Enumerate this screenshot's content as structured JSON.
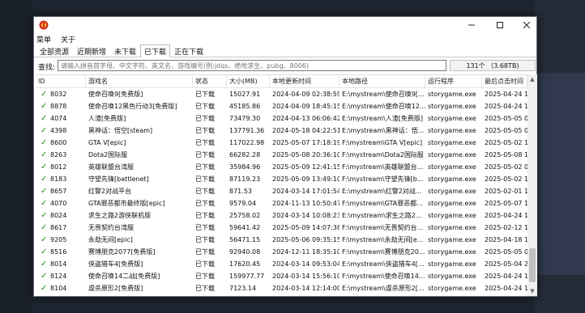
{
  "window": {
    "title": ""
  },
  "menu": {
    "items": [
      "菜单",
      "关于"
    ]
  },
  "tabs": [
    "全部资源",
    "近期新增",
    "未下载",
    "已下载",
    "正在下载"
  ],
  "active_tab": "已下载",
  "search": {
    "label": "查找:",
    "placeholder": "请输入拼音首字母、中文字符、英文名、游戏编号(例:jdqs、绝地求生、pubg、8006)",
    "value": ""
  },
  "count_label": "131个 （3.68TB)",
  "table": {
    "columns": [
      "ID",
      "游戏名",
      "状态",
      "大小(MB)",
      "本地更新时间",
      "本地路径",
      "运行程序",
      "最后点击时间"
    ],
    "rows": [
      [
        "8032",
        "使命召唤9[免费版]",
        "已下载",
        "15027.91",
        "2024-04-09 02:38:59",
        "E:\\mystream\\使命召唤9[...",
        "storygame.exe",
        "2025-04-24 1("
      ],
      [
        "8878",
        "使命召唤12黑色行动3[免费版]",
        "已下载",
        "45185.86",
        "2024-04-09 18:45:15",
        "E:\\mystream\\使命召唤12...",
        "storygame.exe",
        "2025-04-24 1("
      ],
      [
        "4074",
        "人渣[免费版]",
        "已下载",
        "73479.30",
        "2024-04-13 06:06:42",
        "E:\\mystream\\人渣[免费版]",
        "storygame.exe",
        "2025-05-05 0("
      ],
      [
        "4398",
        "黑神话：悟空[steam]",
        "已下载",
        "137791.36",
        "2024-05-18 04:22:51",
        "E:\\mystream\\黑神话：悟...",
        "storygame.exe",
        "2025-05-05 0("
      ],
      [
        "8600",
        "GTA V[epic]",
        "已下载",
        "117022.98",
        "2025-05-07 17:18:19",
        "F:\\mystream\\GTA V[epic]",
        "storygame.exe",
        "2025-05-02 12"
      ],
      [
        "8263",
        "Dota2国际服",
        "已下载",
        "66282.28",
        "2025-05-08 20:36:10",
        "F:\\mystream\\Dota2国际服",
        "storygame.exe",
        "2025-05-08 18"
      ],
      [
        "8012",
        "英雄联盟台湾服",
        "已下载",
        "35984.96",
        "2025-05-09 12:41:15",
        "F:\\mystream\\英雄联盟台...",
        "storygame.exe",
        "2025-05-02 09"
      ],
      [
        "8183",
        "守望先锋[battlenet]",
        "已下载",
        "87119.23",
        "2025-05-09 13:49:10",
        "F:\\mystream\\守望先锋[b...",
        "storygame.exe",
        "2025-05-02 14"
      ],
      [
        "8657",
        "红警2对战平台",
        "已下载",
        "871.53",
        "2024-03-14 17:01:54",
        "E:\\mystream\\红警2对战...",
        "storygame.exe",
        "2025-02-01 1("
      ],
      [
        "4070",
        "GTA罪恶都市最终版[epic]",
        "已下载",
        "9579.04",
        "2024-11-13 10:50:47",
        "F:\\mystream\\GTA罪恶都...",
        "storygame.exe",
        "2025-05-07 19"
      ],
      [
        "8024",
        "求生之路2游侠联机版",
        "已下载",
        "25758.02",
        "2024-03-14 10:08:23",
        "E:\\mystream\\求生之路2...",
        "storygame.exe",
        "2025-04-24 1("
      ],
      [
        "8617",
        "无畏契约台湾服",
        "已下载",
        "59641.42",
        "2025-05-09 14:07:38",
        "F:\\mystream\\无畏契约台...",
        "storygame.exe",
        "2025-02-12 17"
      ],
      [
        "9205",
        "永劫无间[epic]",
        "已下载",
        "56471.15",
        "2025-05-06 09:35:15",
        "F:\\mystream\\永劫无间[e...",
        "storygame.exe",
        "2025-04-18 12"
      ],
      [
        "8516",
        "赛博朋克2077[免费版]",
        "已下载",
        "92940.08",
        "2024-12-11 18:35:10",
        "F:\\mystream\\赛博朋克20...",
        "storygame.exe",
        "2025-05-05 02"
      ],
      [
        "8014",
        "侠盗猎车4[免费版]",
        "已下载",
        "17620.45",
        "2024-03-14 09:53:04",
        "E:\\mystream\\侠盗猎车4[...",
        "storygame.exe",
        "2025-05-04 2("
      ],
      [
        "8124",
        "使命召唤14二战[免费版]",
        "已下载",
        "159977.77",
        "2024-03-14 15:56:10",
        "F:\\mystream\\使命召唤14...",
        "storygame.exe",
        "2025-04-24 1("
      ],
      [
        "8104",
        "虐杀原形2[免费版]",
        "已下载",
        "7123.14",
        "2024-03-14 12:14:00",
        "E:\\mystream\\虐杀原形2[...",
        "storygame.exe",
        "2025-04-24 1("
      ]
    ]
  },
  "colors": {
    "check": "#1e8e1e",
    "accent": "#1e2530"
  },
  "icons": {
    "app": "app-logo-icon",
    "check": "checkmark-icon"
  }
}
